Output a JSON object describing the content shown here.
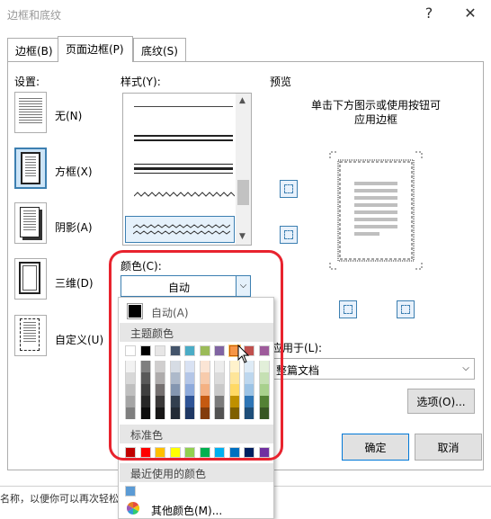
{
  "window": {
    "title": "边框和底纹",
    "help": "?",
    "close": "✕"
  },
  "tabs": [
    {
      "label": "边框(B)"
    },
    {
      "label": "页面边框(P)"
    },
    {
      "label": "底纹(S)"
    }
  ],
  "settings": {
    "header": "设置:",
    "items": [
      {
        "label": "无(N)"
      },
      {
        "label": "方框(X)"
      },
      {
        "label": "阴影(A)"
      },
      {
        "label": "三维(D)"
      },
      {
        "label": "自定义(U)"
      }
    ]
  },
  "style": {
    "header": "样式(Y):"
  },
  "color": {
    "label": "颜色(C):",
    "value": "自动"
  },
  "preview": {
    "header": "预览",
    "hint_line1": "单击下方图示或使用按钮可",
    "hint_line2": "应用边框"
  },
  "apply_to": {
    "label": "应用于(L):",
    "value": "整篇文档"
  },
  "buttons": {
    "options": "选项(O)...",
    "ok": "确定",
    "cancel": "取消"
  },
  "statusbar": {
    "text": "名称，以便你可以再次轻松地应"
  },
  "color_popup": {
    "auto_label": "自动(A)",
    "theme_header": "主题颜色",
    "standard_header": "标准色",
    "recent_header": "最近使用的颜色",
    "more_colors": "其他颜色(M)...",
    "theme_top": [
      "#ffffff",
      "#000000",
      "#e7e6e6",
      "#44546a",
      "#4472c4",
      "#ed7d31",
      "#a5a5a5",
      "#ffc000",
      "#5b9bd5",
      "#70ad47"
    ],
    "theme_rows": [
      [
        "#f2f2f2",
        "#7f7f7f",
        "#d0cece",
        "#d6dce4",
        "#d9e2f3",
        "#fbe5d5",
        "#ededed",
        "#fff2cc",
        "#deebf6",
        "#e2efd9"
      ],
      [
        "#d8d8d8",
        "#595959",
        "#aeabab",
        "#adb9ca",
        "#b4c6e7",
        "#f7cbac",
        "#dbdbdb",
        "#fee599",
        "#bdd7ee",
        "#c5e0b3"
      ],
      [
        "#bfbfbf",
        "#3f3f3f",
        "#757070",
        "#8496b0",
        "#8eaadb",
        "#f4b183",
        "#c9c9c9",
        "#ffd965",
        "#9cc3e5",
        "#a8d08d"
      ],
      [
        "#a5a5a5",
        "#262626",
        "#3a3838",
        "#323f4f",
        "#2f5496",
        "#c55a11",
        "#7b7b7b",
        "#bf9000",
        "#2e75b5",
        "#538135"
      ],
      [
        "#7f7f7f",
        "#0c0c0c",
        "#171616",
        "#222a35",
        "#1f3864",
        "#833c0b",
        "#525252",
        "#7f6000",
        "#1e4e79",
        "#375623"
      ]
    ],
    "standard": [
      "#c00000",
      "#ff0000",
      "#ffc000",
      "#ffff00",
      "#92d050",
      "#00b050",
      "#00b0f0",
      "#0070c0",
      "#002060",
      "#7030a0"
    ],
    "recent": [
      "#5b9bd5"
    ],
    "top_row_override": [
      "#ffffff",
      "#000000",
      "#e7e6e6",
      "#44546a",
      "#4bacc6",
      "#9bbb59",
      "#8064a2",
      "#f79646",
      "#c0504d",
      "#9e5b9b"
    ]
  },
  "highlight_color": "#e8232e",
  "accent": "#3c7fb1"
}
